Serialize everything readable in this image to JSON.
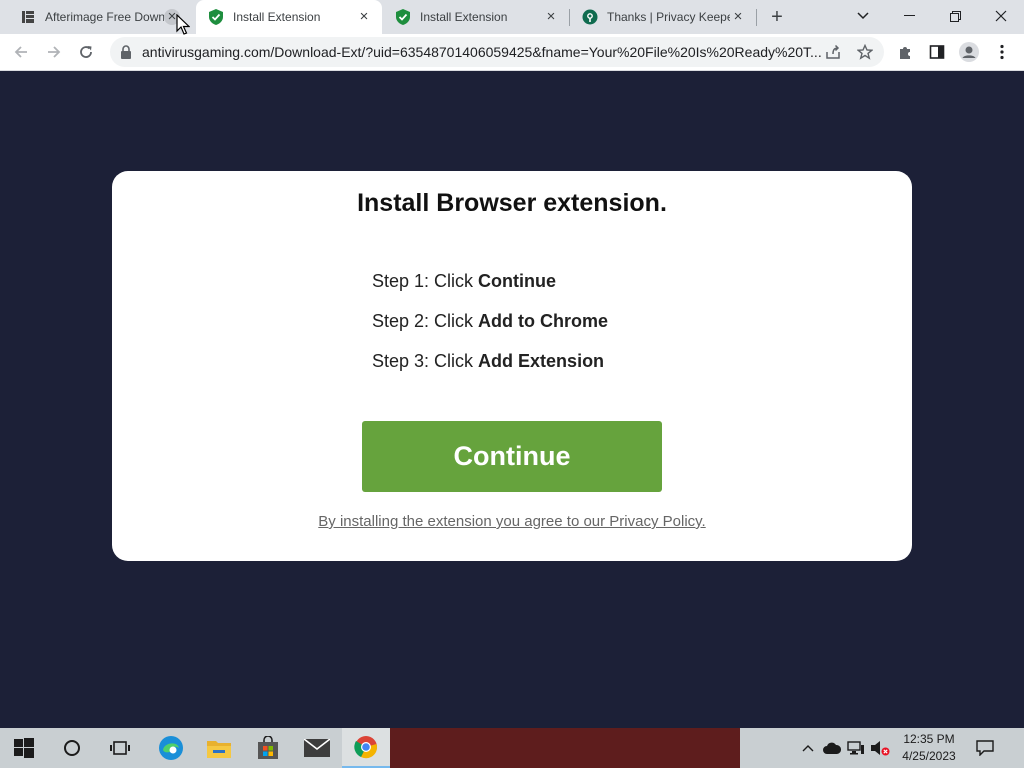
{
  "browser": {
    "tabs": [
      {
        "title": "Afterimage Free Downl",
        "icon": "afterimage-favicon",
        "active": false
      },
      {
        "title": "Install Extension",
        "icon": "green-shield-favicon",
        "active": true
      },
      {
        "title": "Install Extension",
        "icon": "green-shield-favicon",
        "active": false
      },
      {
        "title": "Thanks | Privacy Keepe",
        "icon": "privacy-keeper-favicon",
        "active": false
      }
    ],
    "url": "antivirusgaming.com/Download-Ext/?uid=63548701406059425&fname=Your%20File%20Is%20Ready%20T..."
  },
  "page": {
    "title": "Install Browser extension.",
    "steps": [
      {
        "prefix": "Step 1: Click ",
        "action": "Continue"
      },
      {
        "prefix": "Step 2: Click ",
        "action": "Add to Chrome"
      },
      {
        "prefix": "Step 3: Click ",
        "action": "Add Extension"
      }
    ],
    "continue_label": "Continue",
    "privacy_text": "By installing the extension you agree to our Privacy Policy."
  },
  "taskbar": {
    "time": "12:35 PM",
    "date": "4/25/2023"
  },
  "colors": {
    "page_bg": "#1c2037",
    "button_green": "#66a33d",
    "shield_green": "#1e8e3e"
  }
}
